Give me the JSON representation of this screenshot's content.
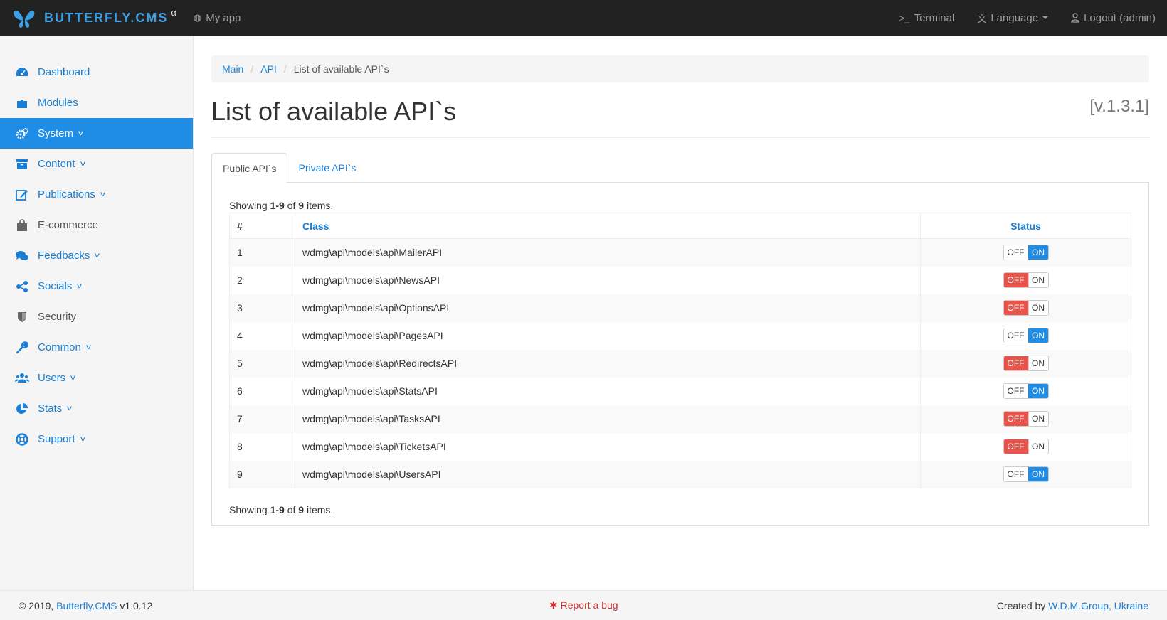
{
  "brand": {
    "name": "BUTTERFLY.CMS",
    "sup": "α",
    "accent": "#3ba0e6"
  },
  "nav": {
    "my_app": "My app",
    "terminal": "Terminal",
    "language": "Language",
    "logout": "Logout (admin)"
  },
  "sidebar": {
    "items": [
      {
        "label": "Dashboard",
        "icon": "dashboard-icon"
      },
      {
        "label": "Modules",
        "icon": "puzzle-icon"
      },
      {
        "label": "System",
        "icon": "cogs-icon",
        "active": true
      },
      {
        "label": "Content",
        "icon": "archive-icon"
      },
      {
        "label": "Publications",
        "icon": "edit-icon"
      },
      {
        "label": "E-commerce",
        "icon": "shopping-bag-icon"
      },
      {
        "label": "Feedbacks",
        "icon": "comments-icon"
      },
      {
        "label": "Socials",
        "icon": "share-icon"
      },
      {
        "label": "Security",
        "icon": "shield-icon"
      },
      {
        "label": "Common",
        "icon": "wrench-icon"
      },
      {
        "label": "Users",
        "icon": "users-icon"
      },
      {
        "label": "Stats",
        "icon": "pie-chart-icon"
      },
      {
        "label": "Support",
        "icon": "life-ring-icon"
      }
    ]
  },
  "breadcrumb": {
    "main": "Main",
    "api": "API",
    "current": "List of available API`s"
  },
  "page": {
    "title": "List of available API`s",
    "version": "[v.1.3.1]"
  },
  "tabs": {
    "public": "Public API`s",
    "private": "Private API`s"
  },
  "summary": {
    "prefix": "Showing ",
    "range": "1-9",
    "of": " of ",
    "total": "9",
    "suffix": " items."
  },
  "table": {
    "headers": {
      "num": "#",
      "class": "Class",
      "status": "Status"
    },
    "toggle": {
      "off": "OFF",
      "on": "ON"
    },
    "rows": [
      {
        "num": "1",
        "class": "wdmg\\api\\models\\api\\MailerAPI",
        "status": "on"
      },
      {
        "num": "2",
        "class": "wdmg\\api\\models\\api\\NewsAPI",
        "status": "off"
      },
      {
        "num": "3",
        "class": "wdmg\\api\\models\\api\\OptionsAPI",
        "status": "off"
      },
      {
        "num": "4",
        "class": "wdmg\\api\\models\\api\\PagesAPI",
        "status": "on"
      },
      {
        "num": "5",
        "class": "wdmg\\api\\models\\api\\RedirectsAPI",
        "status": "off"
      },
      {
        "num": "6",
        "class": "wdmg\\api\\models\\api\\StatsAPI",
        "status": "on"
      },
      {
        "num": "7",
        "class": "wdmg\\api\\models\\api\\TasksAPI",
        "status": "off"
      },
      {
        "num": "8",
        "class": "wdmg\\api\\models\\api\\TicketsAPI",
        "status": "off"
      },
      {
        "num": "9",
        "class": "wdmg\\api\\models\\api\\UsersAPI",
        "status": "on"
      }
    ]
  },
  "footer": {
    "copy": "© 2019, ",
    "cms_link": "Butterfly.CMS",
    "version": " v1.0.12",
    "bug": "Report a bug",
    "created": "Created by ",
    "company": "W.D.M.Group, Ukraine"
  },
  "colors": {
    "on": "#1f8ce6",
    "off": "#e8534a",
    "link": "#1a7fd4"
  }
}
